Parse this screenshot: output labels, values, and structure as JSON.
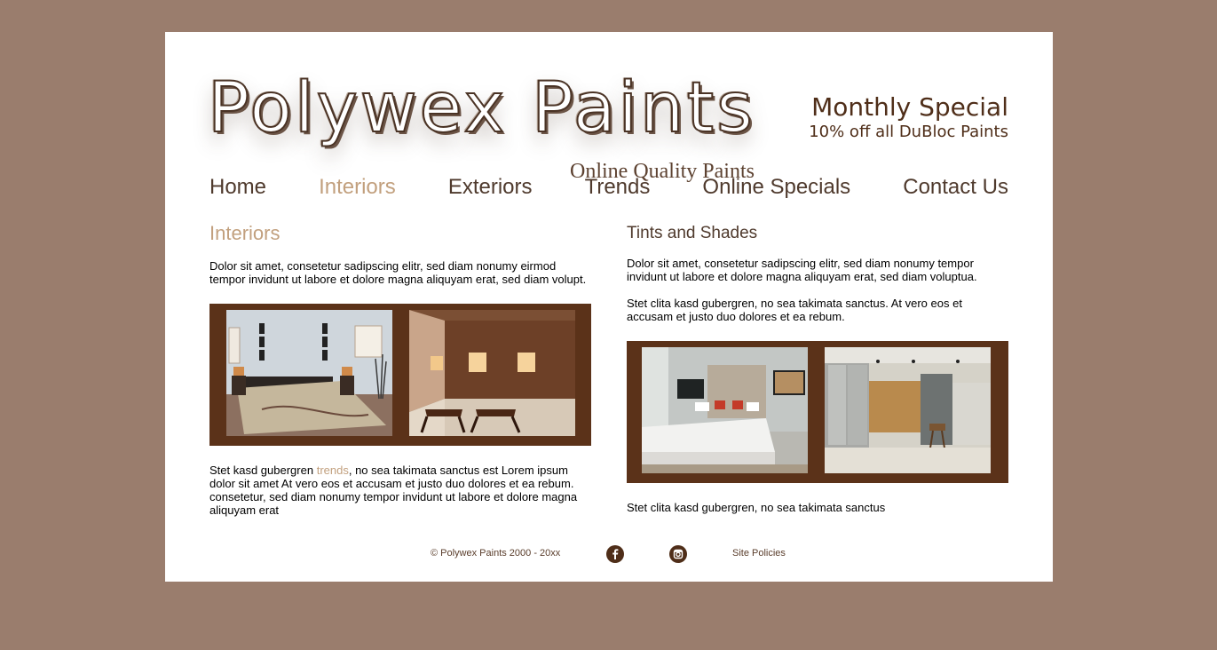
{
  "header": {
    "logo_title": "Polywex Paints",
    "logo_tagline": "Online Quality Paints",
    "special_title": "Monthly Special",
    "special_subtitle": "10% off all DuBloc Paints"
  },
  "nav": {
    "items": [
      {
        "label": "Home",
        "active": false
      },
      {
        "label": "Interiors",
        "active": true
      },
      {
        "label": "Exteriors",
        "active": false
      },
      {
        "label": "Trends",
        "active": false
      },
      {
        "label": "Online Specials",
        "active": false
      },
      {
        "label": "Contact Us",
        "active": false
      }
    ]
  },
  "left": {
    "title": "Interiors",
    "intro": "Dolor sit amet, consetetur sadipscing elitr, sed diam nonumy eirmod tempor invidunt ut labore et dolore magna aliquyam erat, sed diam volupt.",
    "body_before": "Stet kasd gubergren ",
    "body_link": "trends",
    "body_after": ", no sea takimata sanctus est Lorem ipsum dolor sit amet At vero eos et accusam et justo duo dolores et ea rebum. consetetur, sed diam nonumy tempor invidunt ut labore et dolore magna aliquyam erat"
  },
  "right": {
    "title": "Tints and Shades",
    "para1": "Dolor sit amet, consetetur sadipscing elitr, sed diam nonumy tempor invidunt ut labore et dolore magna aliquyam erat, sed diam voluptua.",
    "para2": "Stet clita kasd gubergren, no sea takimata sanctus. At vero eos et accusam et justo duo dolores et ea rebum.",
    "caption": "Stet clita kasd gubergren, no sea takimata sanctus"
  },
  "footer": {
    "copyright": "© Polywex Paints 2000 - 20xx",
    "policies": "Site Policies",
    "social_icons": [
      "facebook-icon",
      "instagram-icon"
    ]
  },
  "colors": {
    "background": "#9a7d6d",
    "brown": "#5b3219",
    "accent": "#c2a07e"
  }
}
